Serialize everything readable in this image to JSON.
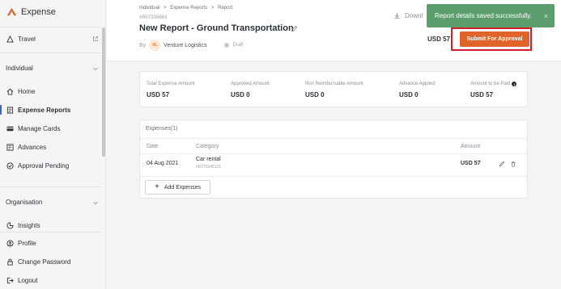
{
  "app": {
    "name": "Expense"
  },
  "sidebar": {
    "travel": {
      "label": "Travel"
    },
    "section_individual": "Individual",
    "items": [
      {
        "label": "Home",
        "icon": "home-icon"
      },
      {
        "label": "Expense Reports",
        "icon": "report-icon",
        "active": true
      },
      {
        "label": "Manage Cards",
        "icon": "card-icon"
      },
      {
        "label": "Advances",
        "icon": "advances-icon"
      },
      {
        "label": "Approval Pending",
        "icon": "approval-icon"
      }
    ],
    "section_organisation": "Organisation",
    "org_items": [
      {
        "label": "Insights",
        "icon": "insights-icon"
      }
    ],
    "footer_items": [
      {
        "label": "Profile",
        "icon": "profile-icon"
      },
      {
        "label": "Change Password",
        "icon": "lock-icon"
      },
      {
        "label": "Logout",
        "icon": "logout-icon"
      }
    ]
  },
  "header": {
    "breadcrumb": [
      "Individual",
      ">",
      "Expense Reports",
      ">",
      "Report"
    ],
    "report_id": "#R07205663",
    "title": "New Report - Ground Transportation",
    "by_label": "By",
    "avatar_initials": "VL",
    "company": "Venture Logistics",
    "status": "Draft",
    "download_label": "Downl",
    "amount": "USD 57",
    "submit_label": "Submit For Approval"
  },
  "toast": {
    "message": "Report details saved successfully.",
    "close": "×"
  },
  "summary": [
    {
      "label": "Total Expense Amount",
      "value": "USD 57"
    },
    {
      "label": "Approved Amount",
      "value": "USD 0"
    },
    {
      "label": "Non Reimbursable Amount",
      "value": "USD 0"
    },
    {
      "label": "Advance Applied",
      "value": "USD 0"
    },
    {
      "label": "Amount to be Paid",
      "value": "USD 57",
      "info": "i"
    }
  ],
  "expenses": {
    "title": "Expenses(1)",
    "columns": {
      "date": "Date",
      "category": "Category",
      "amount": "Amount"
    },
    "rows": [
      {
        "date": "04 Aug 2021",
        "category": "Car rental",
        "id": "#E072045121",
        "amount": "USD 57"
      }
    ],
    "add_label": "Add Expenses"
  },
  "colors": {
    "accent": "#e0642a",
    "toast": "#5c9e6c",
    "highlight": "#d1202a",
    "active": "#3a66e0"
  }
}
